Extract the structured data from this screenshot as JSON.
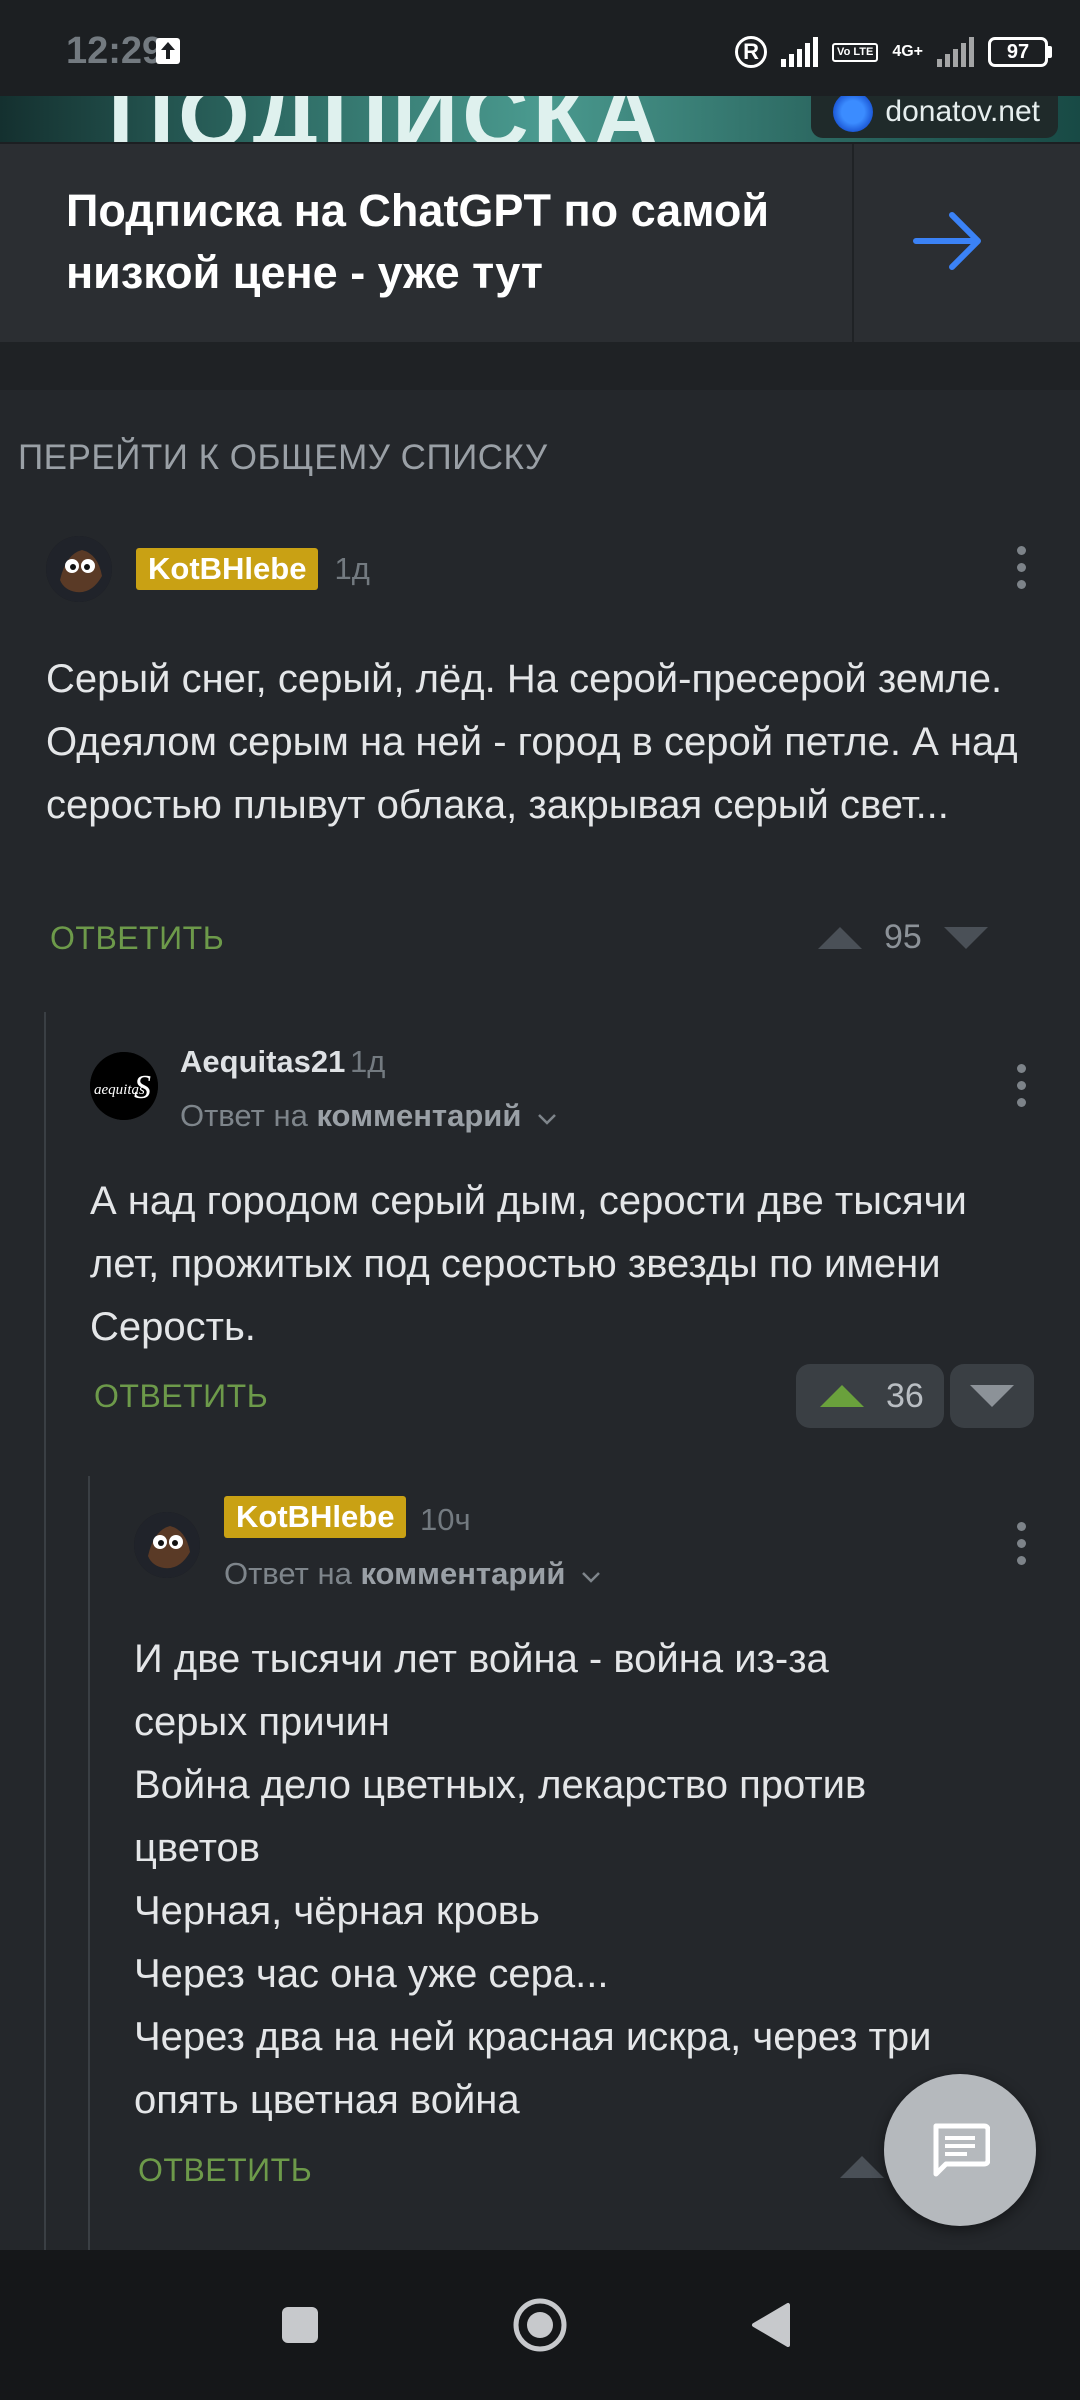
{
  "status_bar": {
    "time": "12:29",
    "battery": "97",
    "volte": "Vo LTE",
    "network": "4G+"
  },
  "banner": {
    "image_text": "ПОДПИСКА",
    "site": "donatov.net"
  },
  "ad": {
    "title": "Подписка на ChatGPT по самой низкой цене - уже тут"
  },
  "go_to_list": "ПЕРЕЙТИ К ОБЩЕМУ СПИСКУ",
  "comments": [
    {
      "author": "KotBHlebe",
      "time": "1д",
      "text": "Серый снег, серый, лёд. На серой-пресерой земле. Одеялом серым на ней - город в серой петле. А над серостью плывут облака, закрывая серый свет...",
      "reply_label": "ОТВЕТИТЬ",
      "rating": "95"
    },
    {
      "author": "Aequitas21",
      "time": "1д",
      "reply_prefix": "Ответ на",
      "reply_link": "комментарий",
      "text": "А над городом серый дым, серости две тысячи лет, прожитых под серостью звезды по имени Серость.",
      "reply_label": "ОТВЕТИТЬ",
      "rating": "36"
    },
    {
      "author": "KotBHlebe",
      "time": "10ч",
      "reply_prefix": "Ответ на",
      "reply_link": "комментарий",
      "lines": [
        "И две тысячи лет война - война из-за",
        "серых причин",
        "Война дело цветных, лекарство против",
        "цветов",
        "Черная, чёрная кровь",
        "Через час она уже сера...",
        "Через два на ней красная искра, через три",
        "опять цветная война"
      ],
      "reply_label": "ОТВЕТИТЬ"
    }
  ],
  "icons": {
    "fab": "comment-icon",
    "nav": [
      "recents-square-icon",
      "home-circle-icon",
      "back-triangle-icon"
    ]
  }
}
